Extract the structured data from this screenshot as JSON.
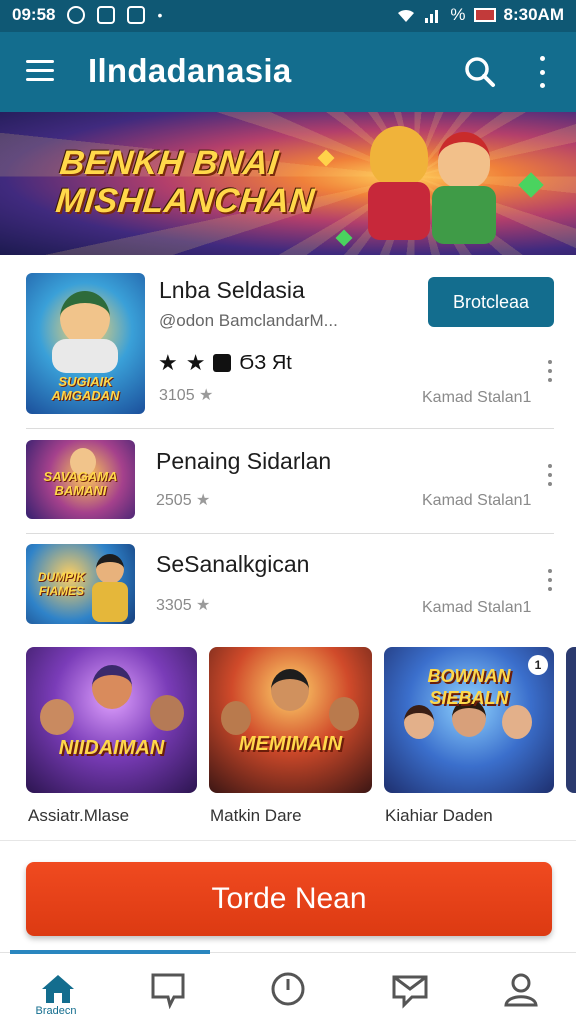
{
  "status_bar": {
    "time": "09:58",
    "clock_right": "8:30AM",
    "battery_text": "%"
  },
  "app_bar": {
    "title": "Ilndadanasia"
  },
  "banner": {
    "line1": "BENKH BNAI",
    "line2": "MISHLANCHAN"
  },
  "apps": [
    {
      "title": "Lnba Seldasia",
      "subtitle": "@odon BamclandarM...",
      "rating_text": "ϬЗ Яt",
      "meta": "3105",
      "right_text": "Kamad Stalan1",
      "install_label": "Brotcleaa",
      "thumb_text": "SUGIAIK AMGADAN"
    },
    {
      "title": "Penaing Sidarlan",
      "meta": "2505",
      "right_text": "Kamad Stalan1",
      "thumb_text": "SAVAGAMA BAMANI"
    },
    {
      "title": "SeSanalkgican",
      "meta": "3305",
      "right_text": "Kamad Stalan1",
      "thumb_text": "DUMPIK FIAMES"
    }
  ],
  "cards": [
    {
      "label": "Assiatr.Mlase",
      "art_text": "NIIDAIMAN"
    },
    {
      "label": "Matkin Dare",
      "art_text": "MEMIMAIN"
    },
    {
      "label": "Kiahiar Daden",
      "art_text": "BOWNAN SIEBALN",
      "badge": "1"
    }
  ],
  "cta": {
    "label": "Torde Nean"
  },
  "bottom_nav": {
    "items": [
      {
        "icon": "home-icon",
        "label": "Bradecn"
      },
      {
        "icon": "chat-bubble-icon"
      },
      {
        "icon": "clock-icon"
      },
      {
        "icon": "mail-icon"
      },
      {
        "icon": "profile-icon"
      }
    ]
  },
  "colors": {
    "app_bar": "#136d8e",
    "status_bar": "#0f5874",
    "accent": "#136d8e",
    "cta": "#e8421a"
  }
}
